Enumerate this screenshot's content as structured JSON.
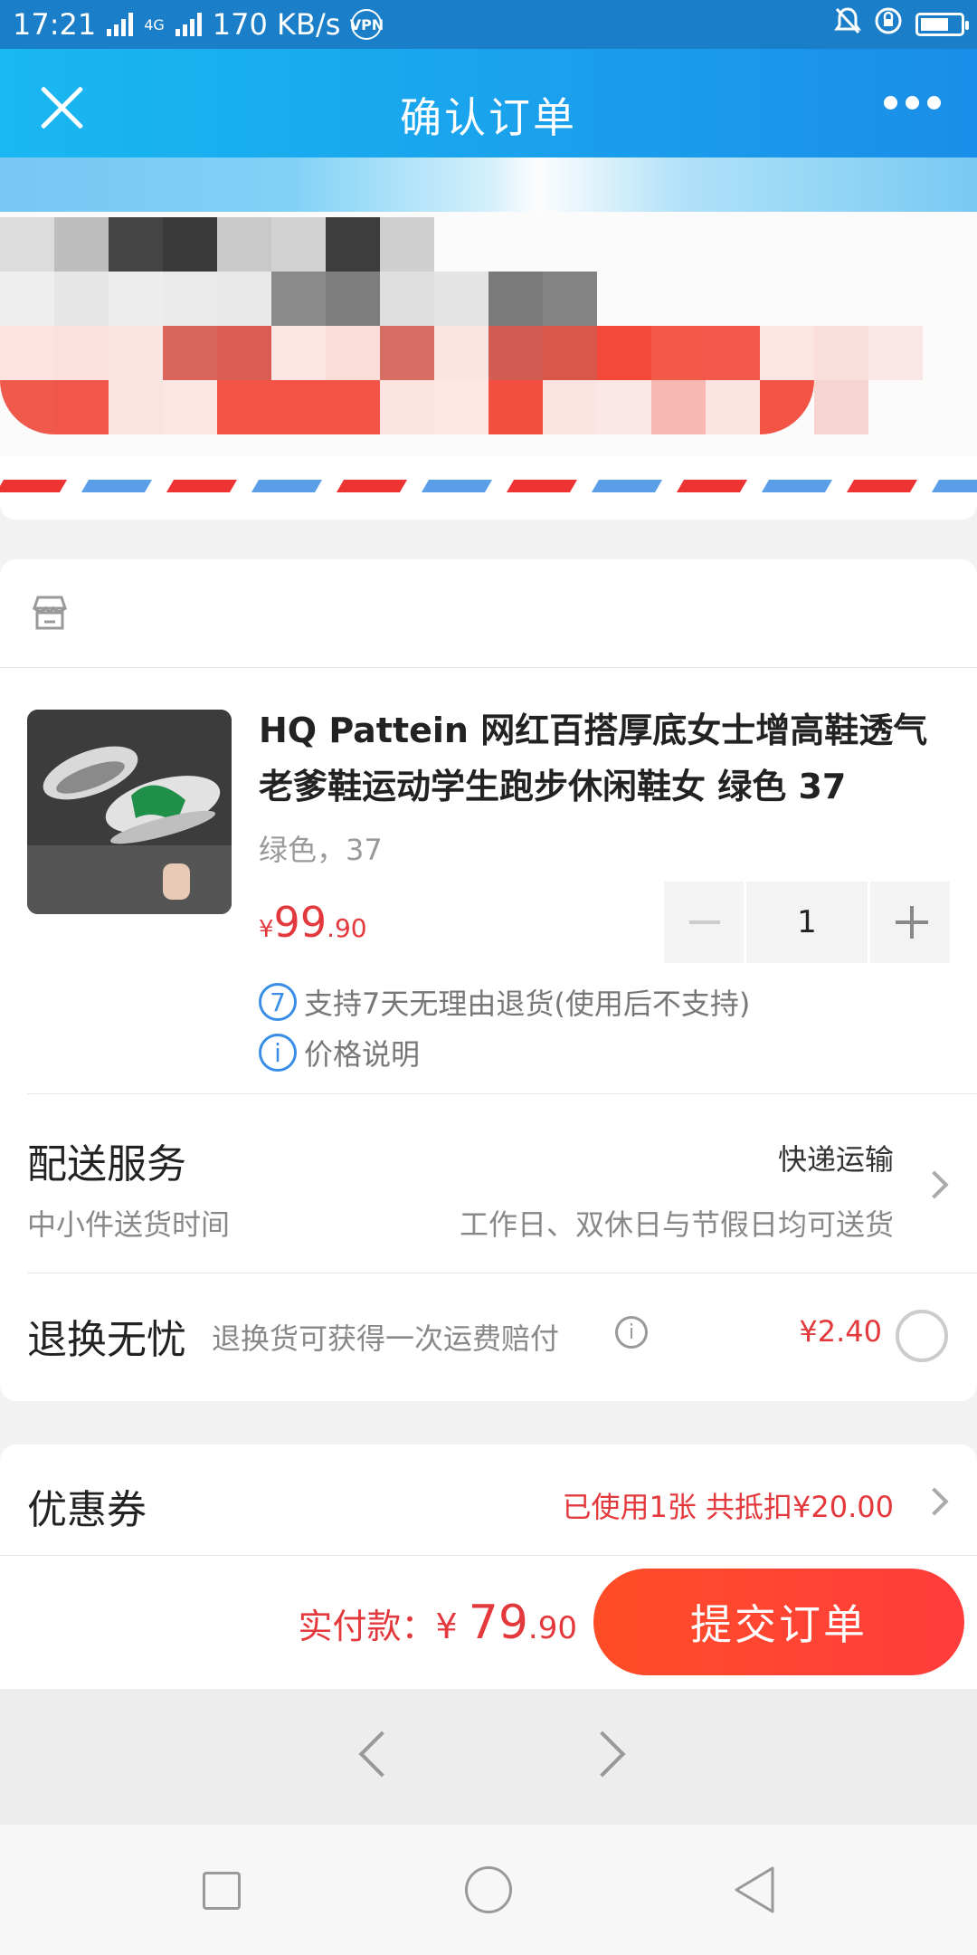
{
  "status_bar": {
    "time": "17:21",
    "network_type": "4G",
    "speed": "170 KB/s",
    "vpn": "VPN"
  },
  "header": {
    "title": "确认订单"
  },
  "product": {
    "title": "HQ Pattein 网红百搭厚底女士增高鞋透气老爹鞋运动学生跑步休闲鞋女 绿色 37",
    "spec": "绿色，37",
    "price_symbol": "¥",
    "price_int": "99",
    "price_dec": ".90",
    "quantity": "1",
    "return_badge": "7",
    "return_note": "支持7天无理由退货(使用后不支持)",
    "info_badge": "i",
    "price_note": "价格说明"
  },
  "delivery": {
    "title": "配送服务",
    "method": "快递运输",
    "sub_left": "中小件送货时间",
    "sub_right": "工作日、双休日与节假日均可送货"
  },
  "return_insurance": {
    "title": "退换无忧",
    "desc": "退换货可获得一次运费赔付",
    "info_badge": "i",
    "price": "¥2.40"
  },
  "coupon": {
    "title": "优惠券",
    "value": "已使用1张 共抵扣¥20.00"
  },
  "paybar": {
    "label": "实付款：",
    "symbol": "¥ ",
    "amount_int": "79",
    "amount_dec": ".90",
    "submit_label": "提交订单"
  },
  "colors": {
    "accent": "#e4393c",
    "header_blue": "#1a8ee8",
    "submit_red": "#ff4d26"
  }
}
